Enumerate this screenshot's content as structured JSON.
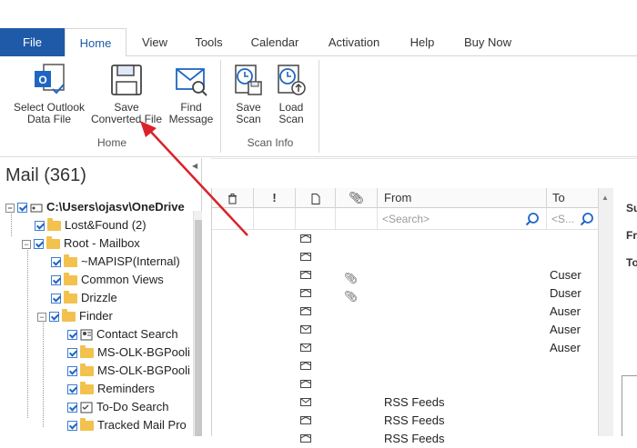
{
  "tabs": [
    "File",
    "Home",
    "View",
    "Tools",
    "Calendar",
    "Activation",
    "Help",
    "Buy Now"
  ],
  "ribbon": {
    "select_outlook": [
      "Select Outlook",
      "Data File"
    ],
    "save_converted": [
      "Save",
      "Converted File"
    ],
    "find_message": [
      "Find",
      "Message"
    ],
    "save_scan": [
      "Save",
      "Scan"
    ],
    "load_scan": [
      "Load",
      "Scan"
    ],
    "group_home": "Home",
    "group_scan_info": "Scan Info"
  },
  "left_panel": {
    "title": "Mail (361)",
    "tree": [
      {
        "label": "C:\\Users\\ojasv\\OneDrive",
        "icon": "drive-icon",
        "toggle": "minus",
        "bold": true
      },
      {
        "label": "Lost&Found (2)",
        "icon": "folder-icon"
      },
      {
        "label": "Root - Mailbox",
        "icon": "folder-icon",
        "toggle": "minus"
      },
      {
        "label": "~MAPISP(Internal)",
        "icon": "folder-icon"
      },
      {
        "label": "Common Views",
        "icon": "folder-icon"
      },
      {
        "label": "Drizzle",
        "icon": "folder-icon"
      },
      {
        "label": "Finder",
        "icon": "folder-icon",
        "toggle": "minus"
      },
      {
        "label": "Contact Search",
        "icon": "contact-card-icon"
      },
      {
        "label": "MS-OLK-BGPooli",
        "icon": "folder-icon"
      },
      {
        "label": "MS-OLK-BGPooli",
        "icon": "folder-icon"
      },
      {
        "label": "Reminders",
        "icon": "folder-icon"
      },
      {
        "label": "To-Do Search",
        "icon": "todo-icon"
      },
      {
        "label": "Tracked Mail Pro",
        "icon": "folder-icon"
      }
    ]
  },
  "grid": {
    "headers": {
      "from": "From",
      "to": "To"
    },
    "search_placeholder_from": "<Search>",
    "search_placeholder_to": "<S...",
    "rows": [
      {
        "icon": "envelope-open",
        "attach": false,
        "from": "",
        "to": ""
      },
      {
        "icon": "envelope-open",
        "attach": false,
        "from": "",
        "to": ""
      },
      {
        "icon": "envelope-open",
        "attach": true,
        "from": "",
        "to": "Cuser"
      },
      {
        "icon": "envelope-open",
        "attach": true,
        "from": "",
        "to": "Duser"
      },
      {
        "icon": "envelope-open",
        "attach": false,
        "from": "",
        "to": "Auser"
      },
      {
        "icon": "envelope",
        "attach": false,
        "from": "",
        "to": "Auser"
      },
      {
        "icon": "envelope",
        "attach": false,
        "from": "",
        "to": "Auser"
      },
      {
        "icon": "envelope-open",
        "attach": false,
        "from": "",
        "to": ""
      },
      {
        "icon": "envelope-open",
        "attach": false,
        "from": "",
        "to": ""
      },
      {
        "icon": "envelope",
        "attach": false,
        "from": "RSS Feeds",
        "to": ""
      },
      {
        "icon": "envelope-open",
        "attach": false,
        "from": "RSS Feeds",
        "to": ""
      },
      {
        "icon": "envelope-open",
        "attach": false,
        "from": "RSS Feeds",
        "to": ""
      }
    ]
  },
  "preview": {
    "labels": [
      "Su",
      "Fr",
      "To"
    ]
  },
  "colors": {
    "file_tab": "#1e5aa8",
    "accent": "#1f66c4",
    "arrow": "#d9232a",
    "folder": "#f2c14e"
  }
}
